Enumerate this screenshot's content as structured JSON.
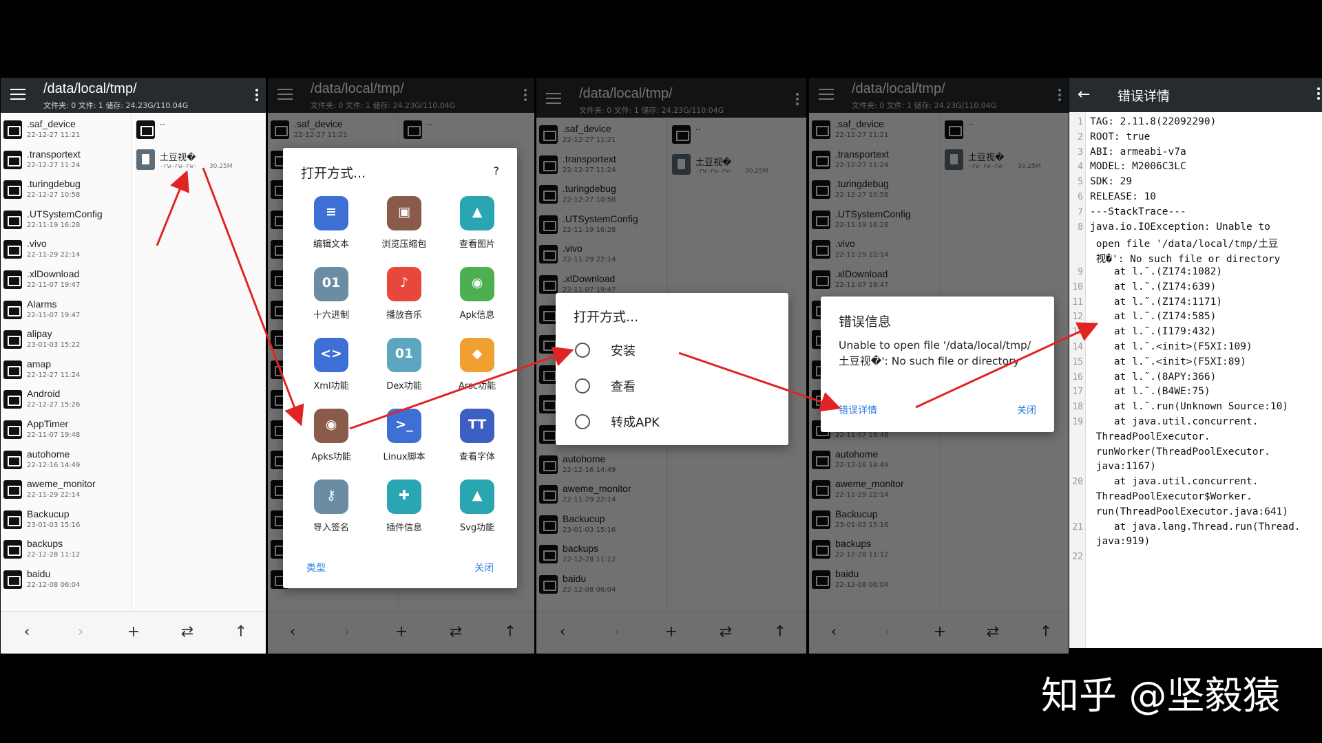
{
  "screen1": {
    "path": "/data/local/tmp/",
    "stats": "文件夹: 0 文件: 1 储存: 24.23G/110.04G",
    "folders": [
      {
        "name": ".saf_device",
        "date": "22-12-27 11:21"
      },
      {
        "name": ".transportext",
        "date": "22-12-27 11:24"
      },
      {
        "name": ".turingdebug",
        "date": "22-12-27 10:58"
      },
      {
        "name": ".UTSystemConfig",
        "date": "22-11-19 16:28"
      },
      {
        "name": ".vivo",
        "date": "22-11-29 22:14"
      },
      {
        "name": ".xlDownload",
        "date": "22-11-07 19:47"
      },
      {
        "name": "Alarms",
        "date": "22-11-07 19:47"
      },
      {
        "name": "alipay",
        "date": "23-01-03 15:22"
      },
      {
        "name": "amap",
        "date": "22-12-27 11:24"
      },
      {
        "name": "Android",
        "date": "22-12-27 15:26"
      },
      {
        "name": "AppTimer",
        "date": "22-11-07 19:48"
      },
      {
        "name": "autohome",
        "date": "22-12-16 14:49"
      },
      {
        "name": "aweme_monitor",
        "date": "22-11-29 22:14"
      },
      {
        "name": "Backucup",
        "date": "23-01-03 15:16"
      },
      {
        "name": "backups",
        "date": "22-12-28 11:12"
      },
      {
        "name": "baidu",
        "date": "22-12-08 06:04"
      }
    ],
    "parent_dir": "..",
    "file": {
      "name": "土豆视�",
      "perm": "-rw-rw-rw-",
      "size": "30.25M"
    },
    "nav": {
      "back": "‹",
      "forward": "›",
      "add": "+",
      "swap": "⇄",
      "up": "↑"
    }
  },
  "screen2": {
    "dialog_title": "打开方式...",
    "help": "?",
    "items": [
      {
        "label": "编辑文本",
        "icon": "edit-text-icon",
        "glyph": "≡",
        "color": "#3d6fd4"
      },
      {
        "label": "浏览压缩包",
        "icon": "archive-icon",
        "glyph": "▣",
        "color": "#8a5a4a"
      },
      {
        "label": "查看图片",
        "icon": "image-icon",
        "glyph": "▲",
        "color": "#2aa6b3"
      },
      {
        "label": "十六进制",
        "icon": "hex-icon",
        "glyph": "01",
        "color": "#6b8da3"
      },
      {
        "label": "播放音乐",
        "icon": "music-icon",
        "glyph": "♪",
        "color": "#e8473b"
      },
      {
        "label": "Apk信息",
        "icon": "android-icon",
        "glyph": "◉",
        "color": "#4caf50"
      },
      {
        "label": "Xml功能",
        "icon": "xml-icon",
        "glyph": "<>",
        "color": "#3d6fd4"
      },
      {
        "label": "Dex功能",
        "icon": "dex-icon",
        "glyph": "01",
        "color": "#5ca7bf"
      },
      {
        "label": "Arsc功能",
        "icon": "layers-icon",
        "glyph": "◆",
        "color": "#f0a030"
      },
      {
        "label": "Apks功能",
        "icon": "apks-icon",
        "glyph": "◉",
        "color": "#8a5a4a"
      },
      {
        "label": "Linux脚本",
        "icon": "script-icon",
        "glyph": ">_",
        "color": "#3d6fd4"
      },
      {
        "label": "查看字体",
        "icon": "font-icon",
        "glyph": "TT",
        "color": "#3d5fc4"
      },
      {
        "label": "导入签名",
        "icon": "key-icon",
        "glyph": "⚷",
        "color": "#6b8da3"
      },
      {
        "label": "插件信息",
        "icon": "plugin-icon",
        "glyph": "✚",
        "color": "#2aa6b3"
      },
      {
        "label": "Svg功能",
        "icon": "svg-icon",
        "glyph": "▲",
        "color": "#2aa6b3"
      }
    ],
    "type_link": "类型",
    "close_link": "关闭"
  },
  "screen3": {
    "dialog_title": "打开方式...",
    "options": [
      "安装",
      "查看",
      "转成APK"
    ]
  },
  "screen4": {
    "dialog_title": "错误信息",
    "message": "Unable to open file '/data/local/tmp/土豆视�': No such file or directory",
    "details_link": "错误详情",
    "close_link": "关闭"
  },
  "screen5": {
    "title": "错误详情",
    "lines": [
      {
        "n": "1",
        "t": "TAG: 2.11.8(22092290)"
      },
      {
        "n": "2",
        "t": "ROOT: true"
      },
      {
        "n": "3",
        "t": "ABI: armeabi-v7a"
      },
      {
        "n": "4",
        "t": "MODEL: M2006C3LC"
      },
      {
        "n": "5",
        "t": "SDK: 29"
      },
      {
        "n": "6",
        "t": "RELEASE: 10"
      },
      {
        "n": "7",
        "t": "---StackTrace---"
      },
      {
        "n": "8",
        "t": "java.io.IOException: Unable to"
      },
      {
        "n": "",
        "t": " open file '/data/local/tmp/土豆"
      },
      {
        "n": "",
        "t": " 视�': No such file or directory"
      },
      {
        "n": "9",
        "t": "    at l.˜.(Z174:1082)"
      },
      {
        "n": "10",
        "t": "    at l.˜.(Z174:639)"
      },
      {
        "n": "11",
        "t": "    at l.˜.(Z174:1171)"
      },
      {
        "n": "12",
        "t": "    at l.˜.(Z174:585)"
      },
      {
        "n": "13",
        "t": "    at l.˜.(I179:432)"
      },
      {
        "n": "14",
        "t": "    at l.˜.<init>(F5XI:109)"
      },
      {
        "n": "15",
        "t": "    at l.˜.<init>(F5XI:89)"
      },
      {
        "n": "16",
        "t": "    at l.˜.(8APY:366)"
      },
      {
        "n": "17",
        "t": "    at l.˜.(B4WE:75)"
      },
      {
        "n": "18",
        "t": "    at l.˜.run(Unknown Source:10)"
      },
      {
        "n": "19",
        "t": "    at java.util.concurrent."
      },
      {
        "n": "",
        "t": " ThreadPoolExecutor."
      },
      {
        "n": "",
        "t": " runWorker(ThreadPoolExecutor."
      },
      {
        "n": "",
        "t": " java:1167)"
      },
      {
        "n": "20",
        "t": "    at java.util.concurrent."
      },
      {
        "n": "",
        "t": " ThreadPoolExecutor$Worker."
      },
      {
        "n": "",
        "t": " run(ThreadPoolExecutor.java:641)"
      },
      {
        "n": "21",
        "t": "    at java.lang.Thread.run(Thread."
      },
      {
        "n": "",
        "t": " java:919)"
      },
      {
        "n": "22",
        "t": ""
      }
    ]
  },
  "watermark": "知乎 @坚毅猿",
  "colors": {
    "topbar": "#262b2f",
    "link": "#2f7de1",
    "arrow": "#e02424"
  }
}
